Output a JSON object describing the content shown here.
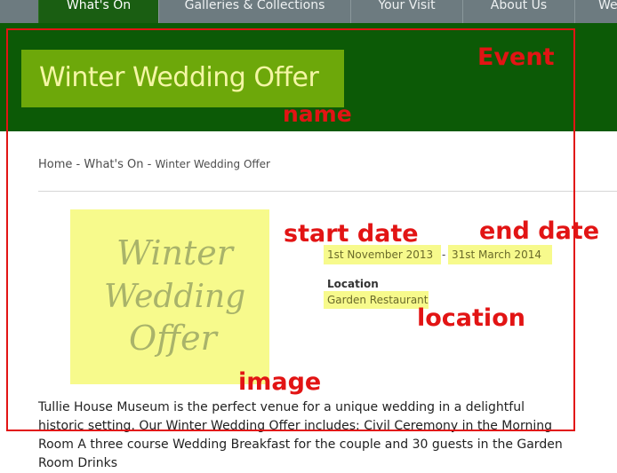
{
  "nav": {
    "tabs": [
      {
        "label": "What's On",
        "active": true
      },
      {
        "label": "Galleries & Collections",
        "active": false
      },
      {
        "label": "Your Visit",
        "active": false
      },
      {
        "label": "About Us",
        "active": false
      },
      {
        "label": "We",
        "active": false
      }
    ]
  },
  "banner": {
    "title": "Winter Wedding Offer"
  },
  "breadcrumb": {
    "home": "Home",
    "sep1": " - ",
    "whats_on": "What's On",
    "sep2": " - ",
    "current": "Winter Wedding Offer"
  },
  "event": {
    "image_text": [
      "Winter",
      "Wedding",
      "Offer"
    ],
    "start_date": "1st November 2013",
    "date_separator": "-",
    "end_date": "31st March 2014",
    "location_label": "Location",
    "location": "Garden Restaurant",
    "description": "Tullie House Museum is the perfect venue for a unique wedding in a delightful historic setting. Our Winter Wedding Offer includes:   Civil Ceremony in the Morning Room A three course Wedding Breakfast for the couple and 30 guests in the Garden Room Drinks"
  },
  "annotations": {
    "event": "Event",
    "name": "name",
    "start_date": "start date",
    "end_date": "end date",
    "location": "location",
    "image": "image"
  },
  "colors": {
    "nav_bg": "#6d7b80",
    "banner_bg": "#0c5a06",
    "title_box": "#6da80a",
    "highlight": "#f7fa8c",
    "annotation_red": "#e21414"
  }
}
